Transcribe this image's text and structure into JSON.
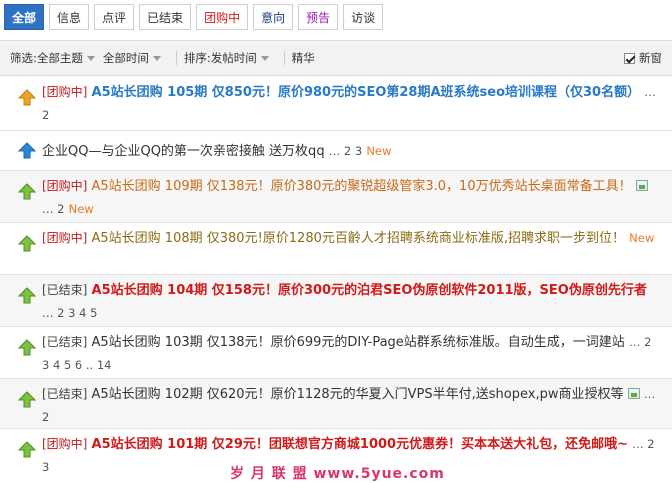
{
  "tabs": [
    {
      "label": "全部",
      "style": "active"
    },
    {
      "label": "信息",
      "style": "normal"
    },
    {
      "label": "点评",
      "style": "normal"
    },
    {
      "label": "已结束",
      "style": "normal"
    },
    {
      "label": "团购中",
      "style": "red"
    },
    {
      "label": "意向",
      "style": "navy"
    },
    {
      "label": "预告",
      "style": "purple"
    },
    {
      "label": "访谈",
      "style": "normal"
    }
  ],
  "filter": {
    "prefix": "筛选:",
    "topic": "全部主题",
    "time": "全部时间",
    "sort_prefix": "排序:",
    "sort": "发帖时间",
    "digest": "精华",
    "newest": "新窗"
  },
  "rows": [
    {
      "tag": "[团购中]",
      "title": "A5站长团购 105期 仅850元！原价980元的SEO第28期A班系统seo培训课程（仅30名额）",
      "pages": "… 2",
      "new": ""
    },
    {
      "tag": "",
      "title": "企业QQ—与企业QQ的第一次亲密接触 送万枚qq",
      "pages": "… 2  3",
      "new": "New"
    },
    {
      "tag": "[团购中]",
      "title": "A5站长团购 109期 仅138元！原价380元的聚锐超级管家3.0，10万优秀站长桌面常备工具！",
      "pages": "… 2",
      "new": "New"
    },
    {
      "tag": "[团购中]",
      "title": "A5站长团购 108期 仅380元!原价1280元百齡人才招聘系统商业标准版,招聘求职一步到位！",
      "pages": "",
      "new": "New"
    },
    {
      "tag": "[已结束]",
      "title": "A5站长团购 104期 仅158元！原价300元的泊君SEO伪原创软件2011版，SEO伪原创先行者",
      "pages": "… 2  3  4  5",
      "new": ""
    },
    {
      "tag": "[已结束]",
      "title": "A5站长团购 103期 仅138元！原价699元的DIY-Page站群系统标准版。自动生成，一词建站",
      "pages": "… 2  3  4  5  6 .. 14",
      "new": ""
    },
    {
      "tag": "[已结束]",
      "title": "A5站长团购 102期 仅620元！原价1128元的华夏入门VPS半年付,送shopex,pw商业授权等",
      "pages": "… 2",
      "new": ""
    },
    {
      "tag": "[团购中]",
      "title": "A5站长团购 101期 仅29元！团联想官方商城1000元优惠券！买本本送大礼包，还免邮哦~",
      "pages": "… 2  3",
      "new": ""
    }
  ],
  "watermark": "岁 月 联 盟  www.5yue.com",
  "colors": {
    "accent": "#2f72c4",
    "red": "#d01a1a",
    "blue_title": "#2a78c8",
    "orange_new": "#f07a2a"
  }
}
